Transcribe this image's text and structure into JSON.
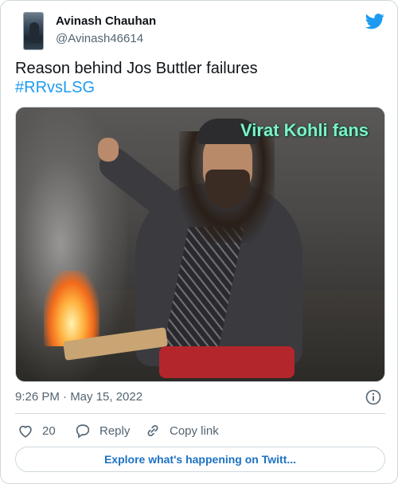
{
  "author": {
    "name": "Avinash Chauhan",
    "handle": "@Avinash46614"
  },
  "tweet": {
    "text": "Reason behind Jos Buttler failures",
    "hashtag": "#RRvsLSG"
  },
  "media": {
    "caption": "Virat Kohli fans"
  },
  "meta": {
    "timestamp": "9:26 PM · May 15, 2022"
  },
  "actions": {
    "like_count": "20",
    "reply_label": "Reply",
    "copy_label": "Copy link"
  },
  "explore": {
    "label": "Explore what's happening on Twitt..."
  },
  "colors": {
    "accent": "#1d9bf0",
    "secondary_text": "#536471",
    "border": "#cfd9de",
    "caption_text": "#7ff0c6"
  },
  "icons": {
    "brand": "twitter-bird-icon",
    "info": "info-icon",
    "like": "heart-icon",
    "reply": "speech-bubble-icon",
    "copy": "link-icon"
  }
}
